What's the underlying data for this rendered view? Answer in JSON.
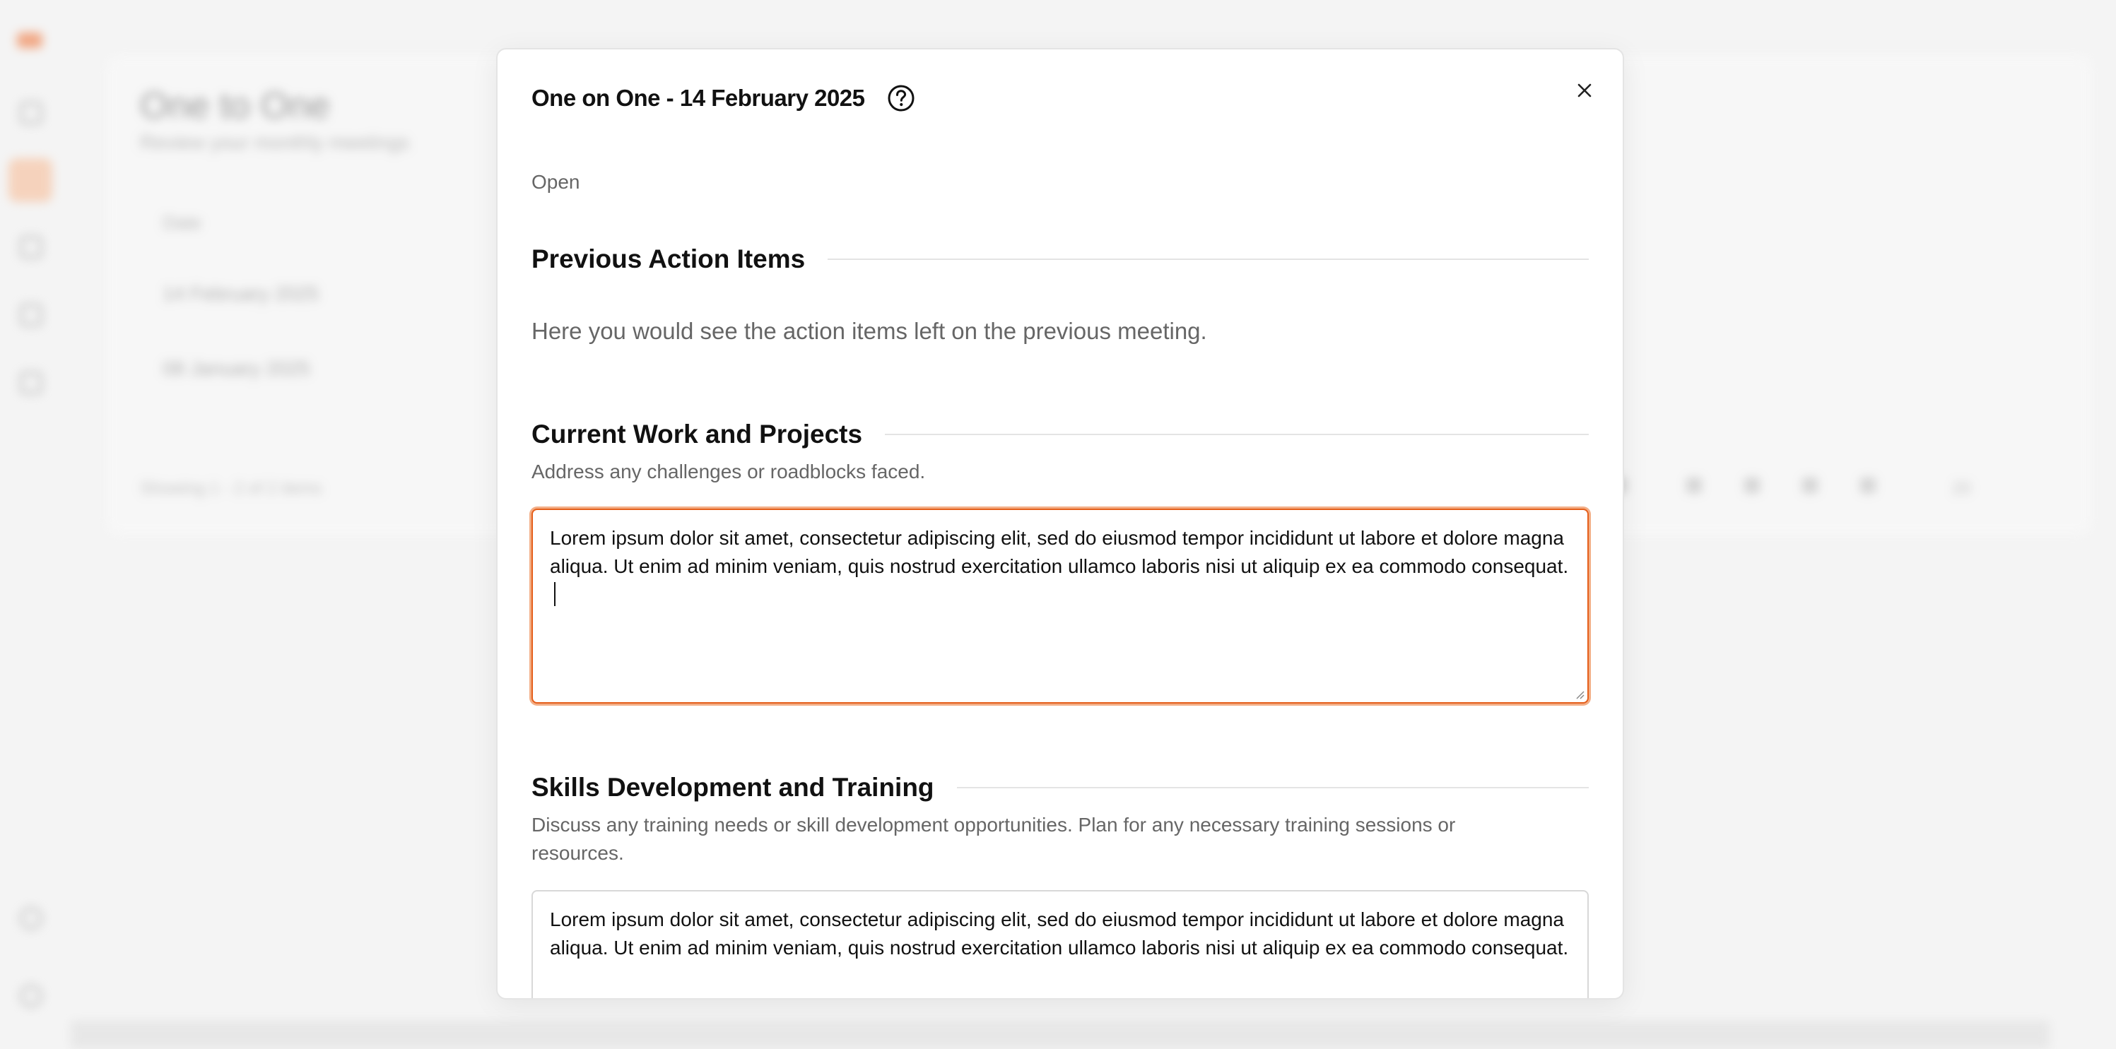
{
  "background": {
    "page_title": "One to One",
    "page_subtitle": "Review your monthly meetings",
    "table_header": "Date",
    "rows": [
      "14 February 2025",
      "08 January 2025"
    ],
    "footer": "Showing 1 - 2 of 2 items",
    "per_page": "20"
  },
  "modal": {
    "title": "One on One - 14 February 2025",
    "status": "Open",
    "help_icon": "question-circle-icon",
    "close_icon": "close-icon",
    "sections": [
      {
        "title": "Previous Action Items",
        "placeholder": "Here you would see the action items left on the previous meeting."
      },
      {
        "title": "Current Work and Projects",
        "description": "Address any challenges or roadblocks faced.",
        "notes": "Lorem ipsum dolor sit amet, consectetur adipiscing elit, sed do eiusmod tempor incididunt ut labore et dolore magna aliqua. Ut enim ad minim veniam, quis nostrud exercitation ullamco laboris nisi ut aliquip ex ea commodo consequat."
      },
      {
        "title": "Skills Development and Training",
        "description": "Discuss any training needs or skill development opportunities. Plan for any necessary training sessions or resources.",
        "notes": "Lorem ipsum dolor sit amet, consectetur adipiscing elit, sed do eiusmod tempor incididunt ut labore et dolore magna aliqua. Ut enim ad minim veniam, quis nostrud exercitation ullamco laboris nisi ut aliquip ex ea commodo consequat."
      }
    ]
  },
  "colors": {
    "accent": "#e55e1a",
    "focus_ring": "#f3ae86",
    "text": "#111111",
    "muted": "#666666"
  }
}
